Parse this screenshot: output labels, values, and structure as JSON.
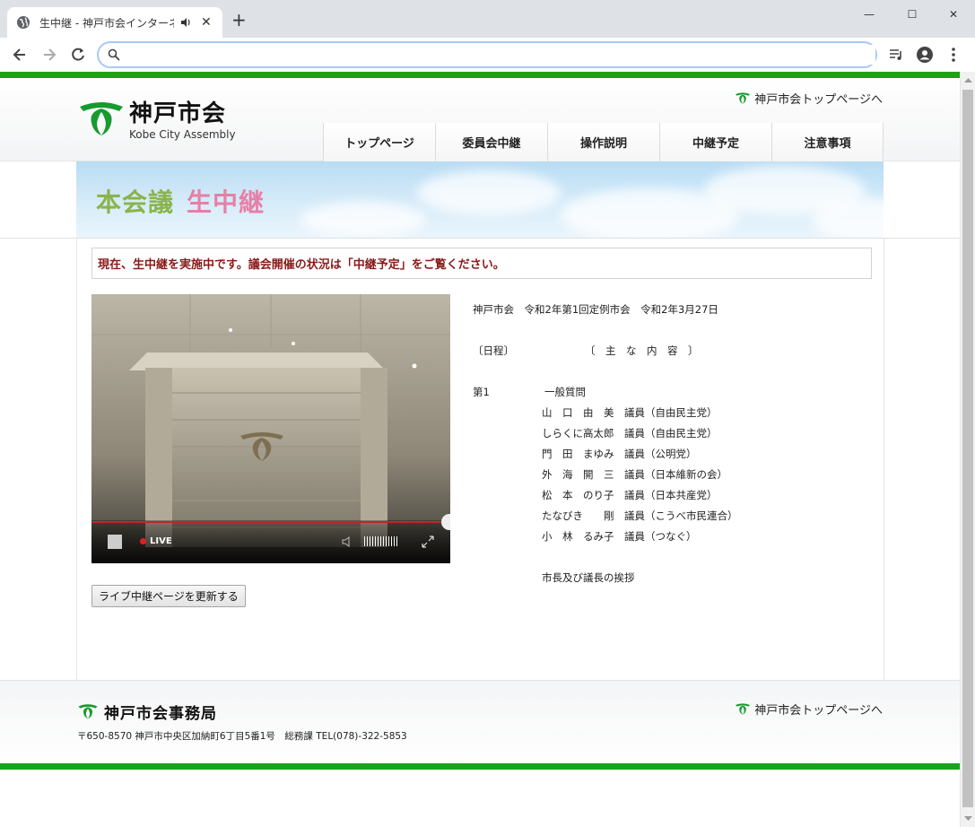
{
  "browser": {
    "tab_title": "生中継 - 神戸市会インターネッ",
    "close_glyph": "✕",
    "newtab_glyph": "+",
    "address": "",
    "min_glyph": "—",
    "max_glyph": "☐",
    "winclose_glyph": "✕"
  },
  "header": {
    "logo_jp": "神戸市会",
    "logo_en": "Kobe City Assembly",
    "top_link": "神戸市会トップページへ",
    "nav": [
      "トップページ",
      "委員会中継",
      "操作説明",
      "中継予定",
      "注意事項"
    ]
  },
  "banner": {
    "part1": "本会議",
    "part2": "生中継"
  },
  "notice": "現在、生中継を実施中です。議会開催の状況は「中継予定」をご覧ください。",
  "player": {
    "live_label": "LIVE"
  },
  "refresh_label": "ライブ中継ページを更新する",
  "session": {
    "title": "神戸市会　令和2年第1回定例市会　令和2年3月27日",
    "schedule_label": "〔日程〕",
    "content_label": "〔　主　な　内　容　〕",
    "day": "第1",
    "item": "一般質問",
    "speakers": [
      "山　口　由　美　議員（自由民主党）",
      "しらくに高太郎　議員（自由民主党）",
      "門　田　まゆみ　議員（公明党）",
      "外　海　開　三　議員（日本維新の会）",
      "松　本　のり子　議員（日本共産党）",
      "たなびき　　剛　議員（こうべ市民連合）",
      "小　林　るみ子　議員（つなぐ）"
    ],
    "closing": "市長及び議長の挨拶"
  },
  "footer": {
    "office": "神戸市会事務局",
    "address": "〒650-8570 神戸市中央区加納町6丁目5番1号　総務課 TEL(078)-322-5853",
    "top_link": "神戸市会トップページへ"
  },
  "colors": {
    "green": "#1aa21a",
    "notice_red": "#8a1a1a",
    "banner_green": "#8bb34b",
    "banner_pink": "#e77fa6"
  }
}
